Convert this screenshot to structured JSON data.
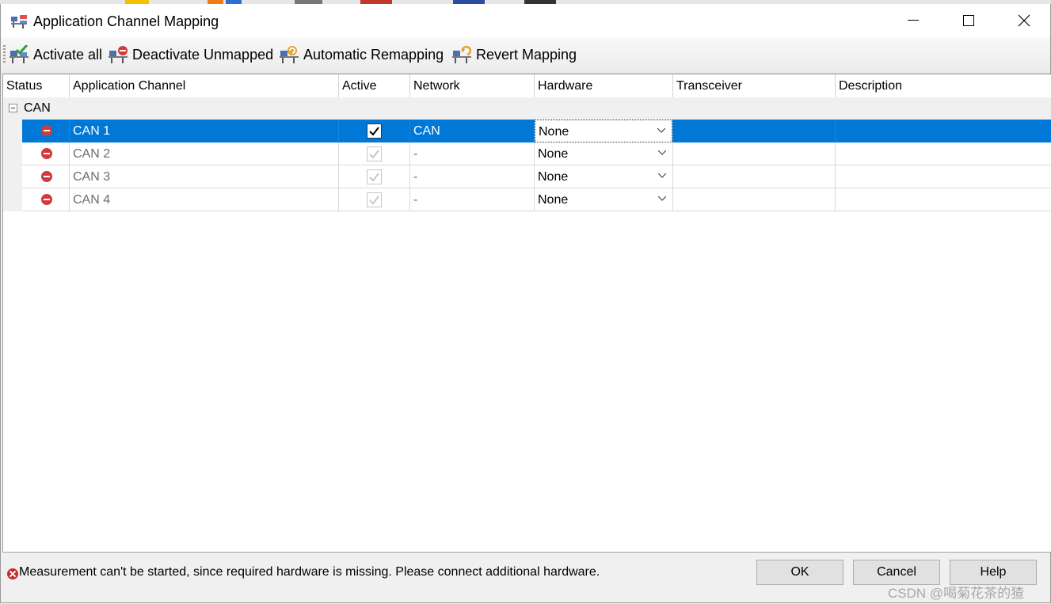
{
  "window": {
    "title": "Application Channel Mapping",
    "icon": "channel-mapping-icon"
  },
  "toolbar": {
    "activate_all": "Activate all",
    "deactivate_unmapped": "Deactivate Unmapped",
    "automatic_remapping": "Automatic Remapping",
    "revert_mapping": "Revert Mapping"
  },
  "grid": {
    "columns": [
      "Status",
      "Application Channel",
      "Active",
      "Network",
      "Hardware",
      "Transceiver",
      "Description"
    ],
    "group": "CAN",
    "rows": [
      {
        "status": "error",
        "channel": "CAN 1",
        "active": true,
        "network": "CAN",
        "hardware": "None",
        "transceiver": "",
        "description": "",
        "selected": true
      },
      {
        "status": "error",
        "channel": "CAN 2",
        "active": true,
        "network": "-",
        "hardware": "None",
        "transceiver": "",
        "description": "",
        "selected": false
      },
      {
        "status": "error",
        "channel": "CAN 3",
        "active": true,
        "network": "-",
        "hardware": "None",
        "transceiver": "",
        "description": "",
        "selected": false
      },
      {
        "status": "error",
        "channel": "CAN 4",
        "active": true,
        "network": "-",
        "hardware": "None",
        "transceiver": "",
        "description": "",
        "selected": false
      }
    ]
  },
  "status_bar": {
    "message": "Measurement can't be started, since required hardware is missing. Please connect additional hardware."
  },
  "buttons": {
    "ok": "OK",
    "cancel": "Cancel",
    "help": "Help"
  },
  "watermark": "CSDN @喝菊花茶的猹",
  "colors": {
    "selection": "#0078d7",
    "error": "#d33b3b",
    "window_bg": "#f0f0f0"
  }
}
